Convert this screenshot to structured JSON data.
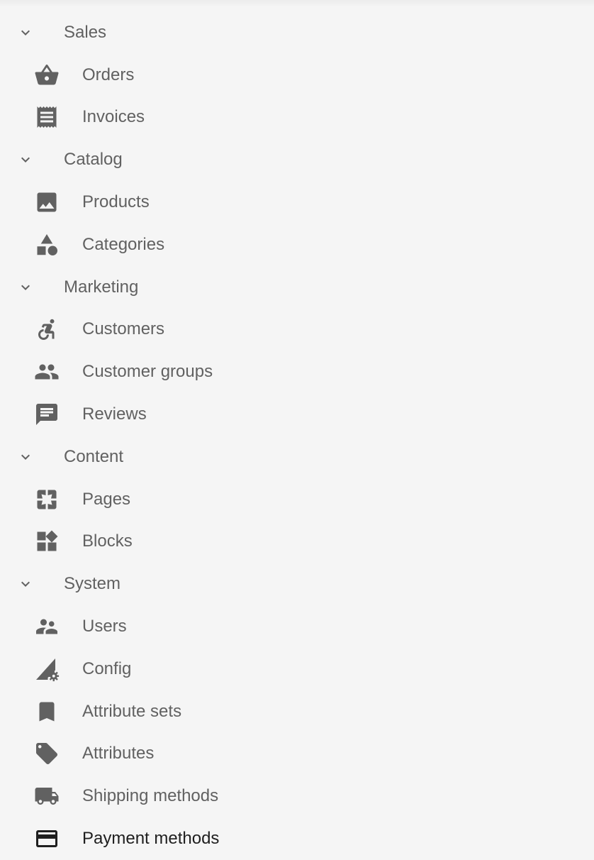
{
  "sidebar": {
    "sections": [
      {
        "label": "Sales",
        "icon": "chevron-down-icon",
        "items": [
          {
            "label": "Orders",
            "icon": "basket-icon"
          },
          {
            "label": "Invoices",
            "icon": "receipt-icon"
          }
        ]
      },
      {
        "label": "Catalog",
        "icon": "chevron-down-icon",
        "items": [
          {
            "label": "Products",
            "icon": "image-icon"
          },
          {
            "label": "Categories",
            "icon": "shapes-icon"
          }
        ]
      },
      {
        "label": "Marketing",
        "icon": "chevron-down-icon",
        "items": [
          {
            "label": "Customers",
            "icon": "accessible-icon"
          },
          {
            "label": "Customer groups",
            "icon": "people-icon"
          },
          {
            "label": "Reviews",
            "icon": "comment-icon"
          }
        ]
      },
      {
        "label": "Content",
        "icon": "chevron-down-icon",
        "items": [
          {
            "label": "Pages",
            "icon": "pages-icon"
          },
          {
            "label": "Blocks",
            "icon": "widgets-icon"
          }
        ]
      },
      {
        "label": "System",
        "icon": "chevron-down-icon",
        "items": [
          {
            "label": "Users",
            "icon": "supervisor-icon"
          },
          {
            "label": "Config",
            "icon": "network-settings-icon"
          },
          {
            "label": "Attribute sets",
            "icon": "bookmark-icon"
          },
          {
            "label": "Attributes",
            "icon": "tag-icon"
          },
          {
            "label": "Shipping methods",
            "icon": "truck-icon"
          },
          {
            "label": "Payment methods",
            "icon": "credit-card-icon",
            "active": true
          }
        ]
      }
    ]
  },
  "colors": {
    "background": "#f5f5f5",
    "icon": "#616161",
    "text": "#616161",
    "active_text": "#1f1f1f"
  }
}
